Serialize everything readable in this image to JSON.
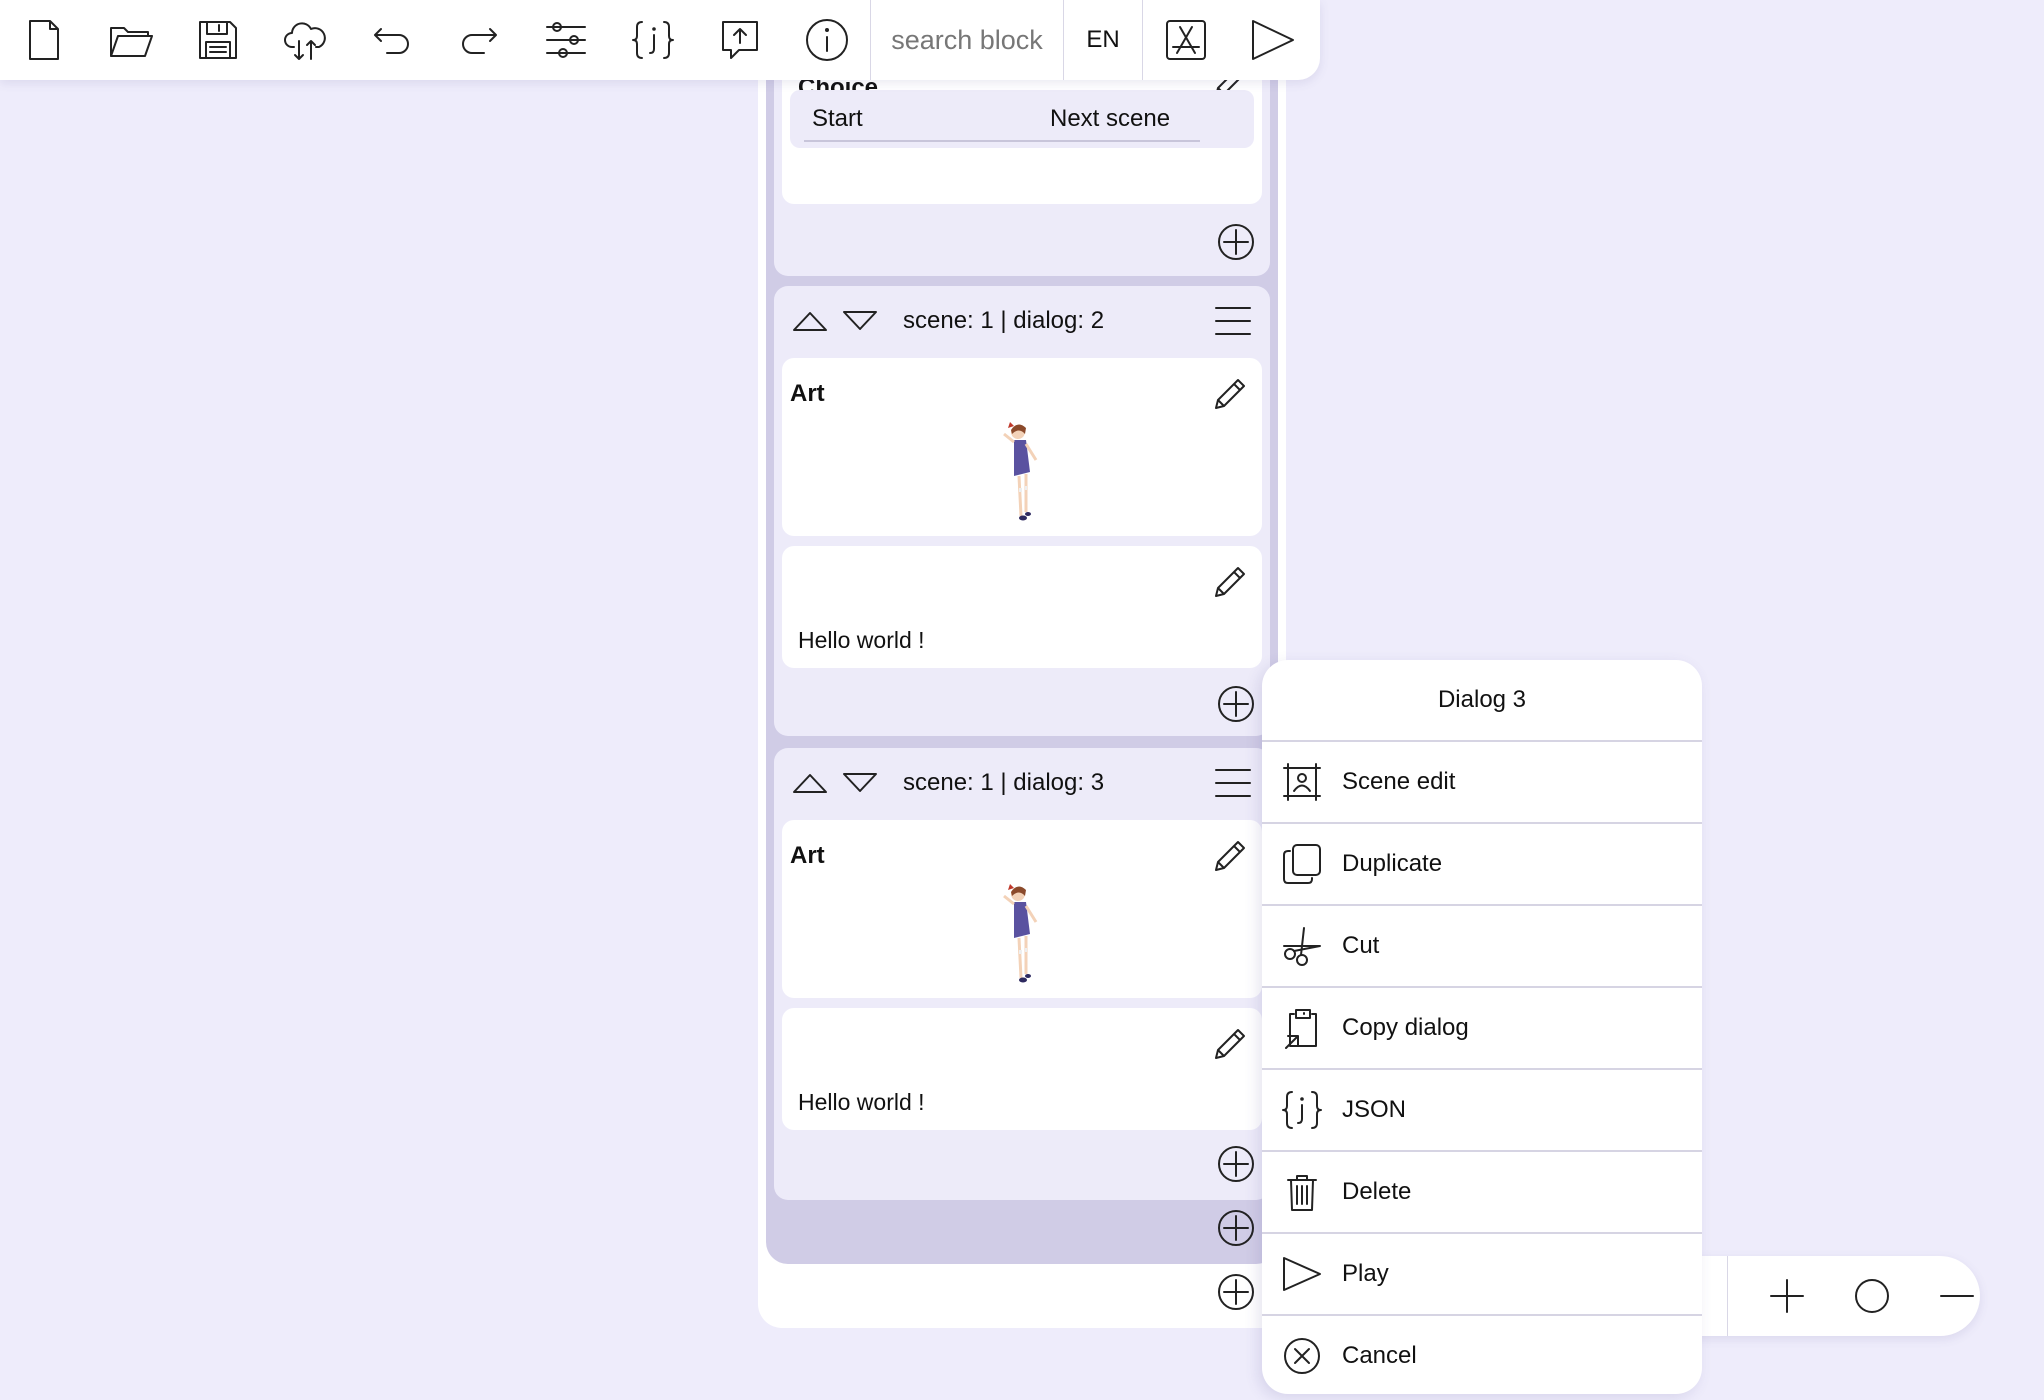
{
  "toolbar": {
    "search_placeholder": "search block",
    "language": "EN",
    "buttons": [
      {
        "icon": "new-file-icon"
      },
      {
        "icon": "open-folder-icon"
      },
      {
        "icon": "save-icon"
      },
      {
        "icon": "cloud-sync-icon"
      },
      {
        "icon": "undo-icon"
      },
      {
        "icon": "redo-icon"
      },
      {
        "icon": "settings-sliders-icon"
      },
      {
        "icon": "json-braces-icon"
      },
      {
        "icon": "export-icon"
      },
      {
        "icon": "info-icon"
      }
    ],
    "right_buttons": [
      {
        "icon": "app-store-icon"
      },
      {
        "icon": "play-icon"
      }
    ]
  },
  "choice_block": {
    "title": "Choice",
    "options": [
      "Start",
      "Next scene"
    ]
  },
  "dialogs": [
    {
      "header": "scene: 1 | dialog: 2",
      "art_title": "Art",
      "text": "Hello world !"
    },
    {
      "header": "scene: 1 | dialog: 3",
      "art_title": "Art",
      "text": "Hello world !"
    }
  ],
  "context_menu": {
    "title": "Dialog 3",
    "items": [
      {
        "label": "Scene edit",
        "icon": "scene-edit-icon"
      },
      {
        "label": "Duplicate",
        "icon": "duplicate-icon"
      },
      {
        "label": "Cut",
        "icon": "scissors-icon"
      },
      {
        "label": "Copy dialog",
        "icon": "clipboard-icon"
      },
      {
        "label": "JSON",
        "icon": "json-braces-icon"
      },
      {
        "label": "Delete",
        "icon": "trash-icon"
      },
      {
        "label": "Play",
        "icon": "play-icon"
      },
      {
        "label": "Cancel",
        "icon": "cancel-icon"
      }
    ]
  },
  "zoom_controls": [
    "zoom-in-icon",
    "zoom-reset-icon",
    "zoom-out-icon"
  ],
  "colors": {
    "background": "#eeecfb",
    "dialog_card": "#edebf9",
    "scene_background": "#d0cce6",
    "panel": "#ffffff",
    "divider": "#d6d4e3"
  }
}
